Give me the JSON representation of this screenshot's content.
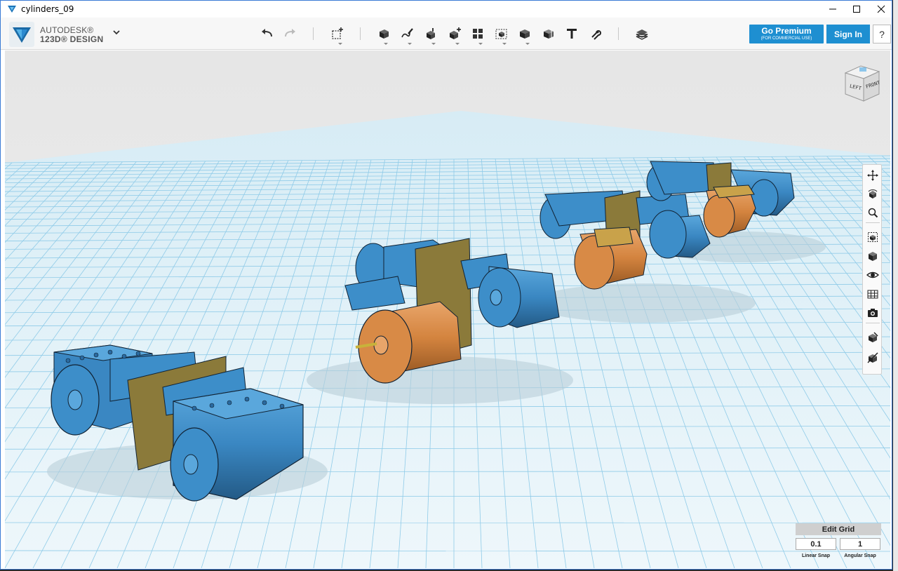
{
  "window": {
    "title": "cylinders_09"
  },
  "brand": {
    "line1": "AUTODESK®",
    "line2": "123D® DESIGN"
  },
  "toolbar": {
    "undo": "undo-icon",
    "redo": "redo-icon",
    "tools": [
      "transform-icon",
      "primitives-icon",
      "sketch-icon",
      "construct-icon",
      "modify-icon",
      "pattern-icon",
      "grouping-icon",
      "combine-icon",
      "measure-icon",
      "text-icon",
      "snap-icon",
      "material-icon"
    ]
  },
  "account": {
    "premium_label": "Go Premium",
    "premium_sub": "(FOR COMMERCIAL USE)",
    "signin_label": "Sign In",
    "help_label": "?"
  },
  "viewcube": {
    "left_face": "LEFT",
    "front_face": "FRONT"
  },
  "navbar": {
    "buttons": [
      "pan-icon",
      "orbit-icon",
      "zoom-icon",
      "fit-icon",
      "view-cube-icon",
      "visibility-icon",
      "grid-icon",
      "screenshot-icon",
      "material-view-icon",
      "hide-icon"
    ]
  },
  "grid": {
    "edit_label": "Edit Grid",
    "linear_snap_value": "0.1",
    "angular_snap_value": "1",
    "linear_snap_label": "Linear Snap",
    "angular_snap_label": "Angular Snap"
  },
  "colors": {
    "accent": "#1e8fd1",
    "part_blue": "#3d8ec9",
    "part_orange": "#d88a46",
    "plate_olive": "#8b7a3a",
    "grid_line": "#7ec3e6",
    "ground": "#dceef5"
  }
}
